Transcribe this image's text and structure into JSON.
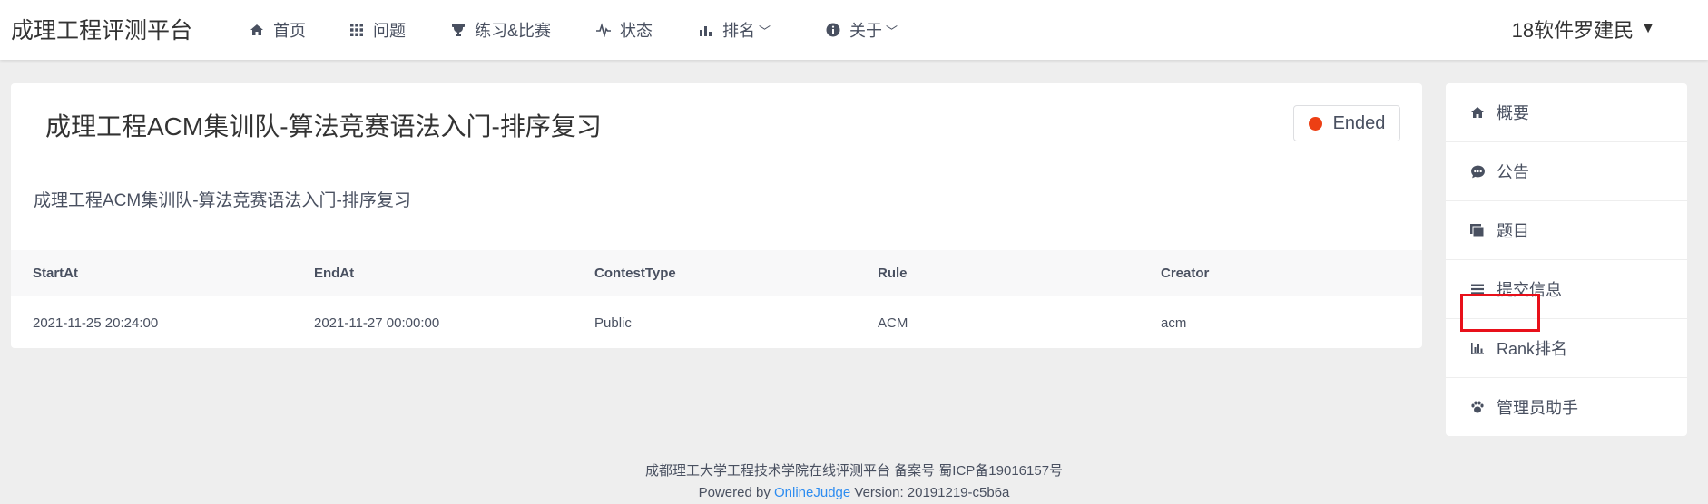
{
  "brand": "成理工程评测平台",
  "nav": {
    "home": "首页",
    "problems": "问题",
    "contests": "练习&比赛",
    "status": "状态",
    "rank": "排名",
    "about": "关于"
  },
  "user": {
    "name": "18软件罗建民"
  },
  "contest": {
    "title": "成理工程ACM集训队-算法竞赛语法入门-排序复习",
    "status": "Ended",
    "status_color": "#ed3f14",
    "description": "成理工程ACM集训队-算法竞赛语法入门-排序复习"
  },
  "table": {
    "headers": [
      "StartAt",
      "EndAt",
      "ContestType",
      "Rule",
      "Creator"
    ],
    "row": [
      "2021-11-25 20:24:00",
      "2021-11-27 00:00:00",
      "Public",
      "ACM",
      "acm"
    ]
  },
  "side_menu": {
    "items": [
      {
        "label": "概要",
        "icon": "home-icon"
      },
      {
        "label": "公告",
        "icon": "chat-icon"
      },
      {
        "label": "题目",
        "icon": "files-icon"
      },
      {
        "label": "提交信息",
        "icon": "list-icon"
      },
      {
        "label": "Rank排名",
        "icon": "bar-chart-icon"
      },
      {
        "label": "管理员助手",
        "icon": "paw-icon"
      }
    ]
  },
  "footer": {
    "line1": "成都理工大学工程技术学院在线评测平台 备案号 蜀ICP备19016157号",
    "powered_prefix": "Powered by",
    "powered_link": "OnlineJudge",
    "version": "Version: 20191219-c5b6a"
  }
}
